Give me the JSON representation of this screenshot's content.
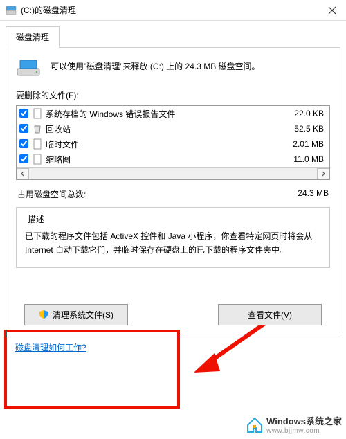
{
  "window": {
    "title": "(C:)的磁盘清理"
  },
  "tab": {
    "label": "磁盘清理"
  },
  "intro": "可以使用\"磁盘清理\"来释放  (C:) 上的 24.3 MB 磁盘空间。",
  "filesLabel": "要删除的文件(F):",
  "files": [
    {
      "checked": true,
      "icon": "file-icon",
      "name": "系统存档的 Windows 错误报告文件",
      "size": "22.0 KB"
    },
    {
      "checked": true,
      "icon": "recycle-icon",
      "name": "回收站",
      "size": "52.5 KB"
    },
    {
      "checked": true,
      "icon": "file-icon",
      "name": "临时文件",
      "size": "2.01 MB"
    },
    {
      "checked": true,
      "icon": "file-icon",
      "name": "缩略图",
      "size": "11.0 MB"
    }
  ],
  "total": {
    "label": "占用磁盘空间总数:",
    "value": "24.3 MB"
  },
  "description": {
    "title": "描述",
    "text": "已下载的程序文件包括 ActiveX 控件和 Java 小程序，你查看特定网页时将会从 Internet 自动下载它们，并临时保存在硬盘上的已下载的程序文件夹中。"
  },
  "buttons": {
    "cleanSystem": "清理系统文件(S)",
    "viewFiles": "查看文件(V)"
  },
  "link": "磁盘清理如何工作?",
  "watermark": {
    "brand": "Windows系统之家",
    "url": "www.bjjmw.com"
  }
}
